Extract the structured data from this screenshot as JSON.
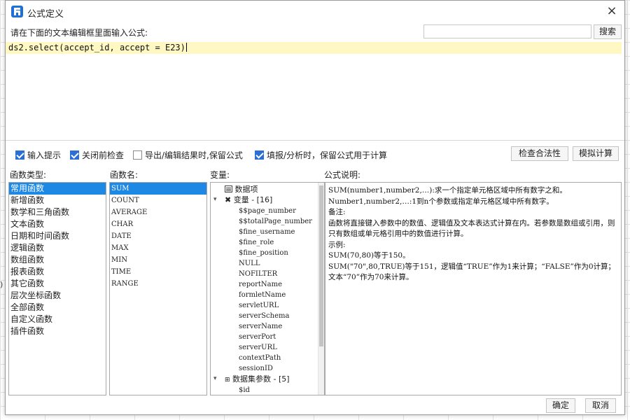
{
  "background": {
    "edge_mark": ")"
  },
  "dialog": {
    "title": "公式定义",
    "close_glyph": "×"
  },
  "prompt": {
    "label": "请在下面的文本编辑框里面输入公式:"
  },
  "search": {
    "placeholder": "",
    "button": "搜索"
  },
  "editor": {
    "code": "ds2.select(accept_id, accept = E23)"
  },
  "options": [
    {
      "label": "输入提示",
      "checked": true
    },
    {
      "label": "关闭前检查",
      "checked": true
    },
    {
      "label": "导出/编辑结果时,保留公式",
      "checked": false
    },
    {
      "label": "填报/分析时，保留公式用于计算",
      "checked": true
    }
  ],
  "actions": {
    "validate": "检查合法性",
    "simulate": "模拟计算",
    "ok": "确定",
    "cancel": "取消"
  },
  "columns": {
    "category": "函数类型:",
    "function": "函数名:",
    "variable": "变量:",
    "description": "公式说明:"
  },
  "categories": [
    "常用函数",
    "新增函数",
    "数学和三角函数",
    "文本函数",
    "日期和时间函数",
    "逻辑函数",
    "数组函数",
    "报表函数",
    "其它函数",
    "层次坐标函数",
    "全部函数",
    "自定义函数",
    "插件函数"
  ],
  "functions": [
    "SUM",
    "COUNT",
    "AVERAGE",
    "CHAR",
    "DATE",
    "MAX",
    "MIN",
    "TIME",
    "RANGE"
  ],
  "variables": {
    "data_item": "数据项",
    "var_group": "变量 - [16]",
    "vars": [
      "$$page_number",
      "$$totalPage_number",
      "$fine_username",
      "$fine_role",
      "$fine_position",
      "NULL",
      "NOFILTER",
      "reportName",
      "formletName",
      "servletURL",
      "serverSchema",
      "serverName",
      "serverPort",
      "serverURL",
      "contextPath",
      "sessionID"
    ],
    "dataset_group": "数据集参数 - [5]",
    "dataset_vars": [
      "$id"
    ]
  },
  "description": [
    "SUM(number1,number2,…):求一个指定单元格区域中所有数字之和。",
    "Number1,number2,…:1到n个参数或指定单元格区域中所有数字。",
    "备注:",
    "函数将直接键入参数中的数值、逻辑值及文本表达式计算在内。若参数是数组或引用，则只有数组或单元格引用中的数值进行计算。",
    "示例:",
    "SUM(70,80)等于150。",
    "SUM(\"70\",80,TRUE)等于151，逻辑值“TRUE”作为1来计算；“FALSE”作为0计算；文本“70”作为70来计算。"
  ]
}
